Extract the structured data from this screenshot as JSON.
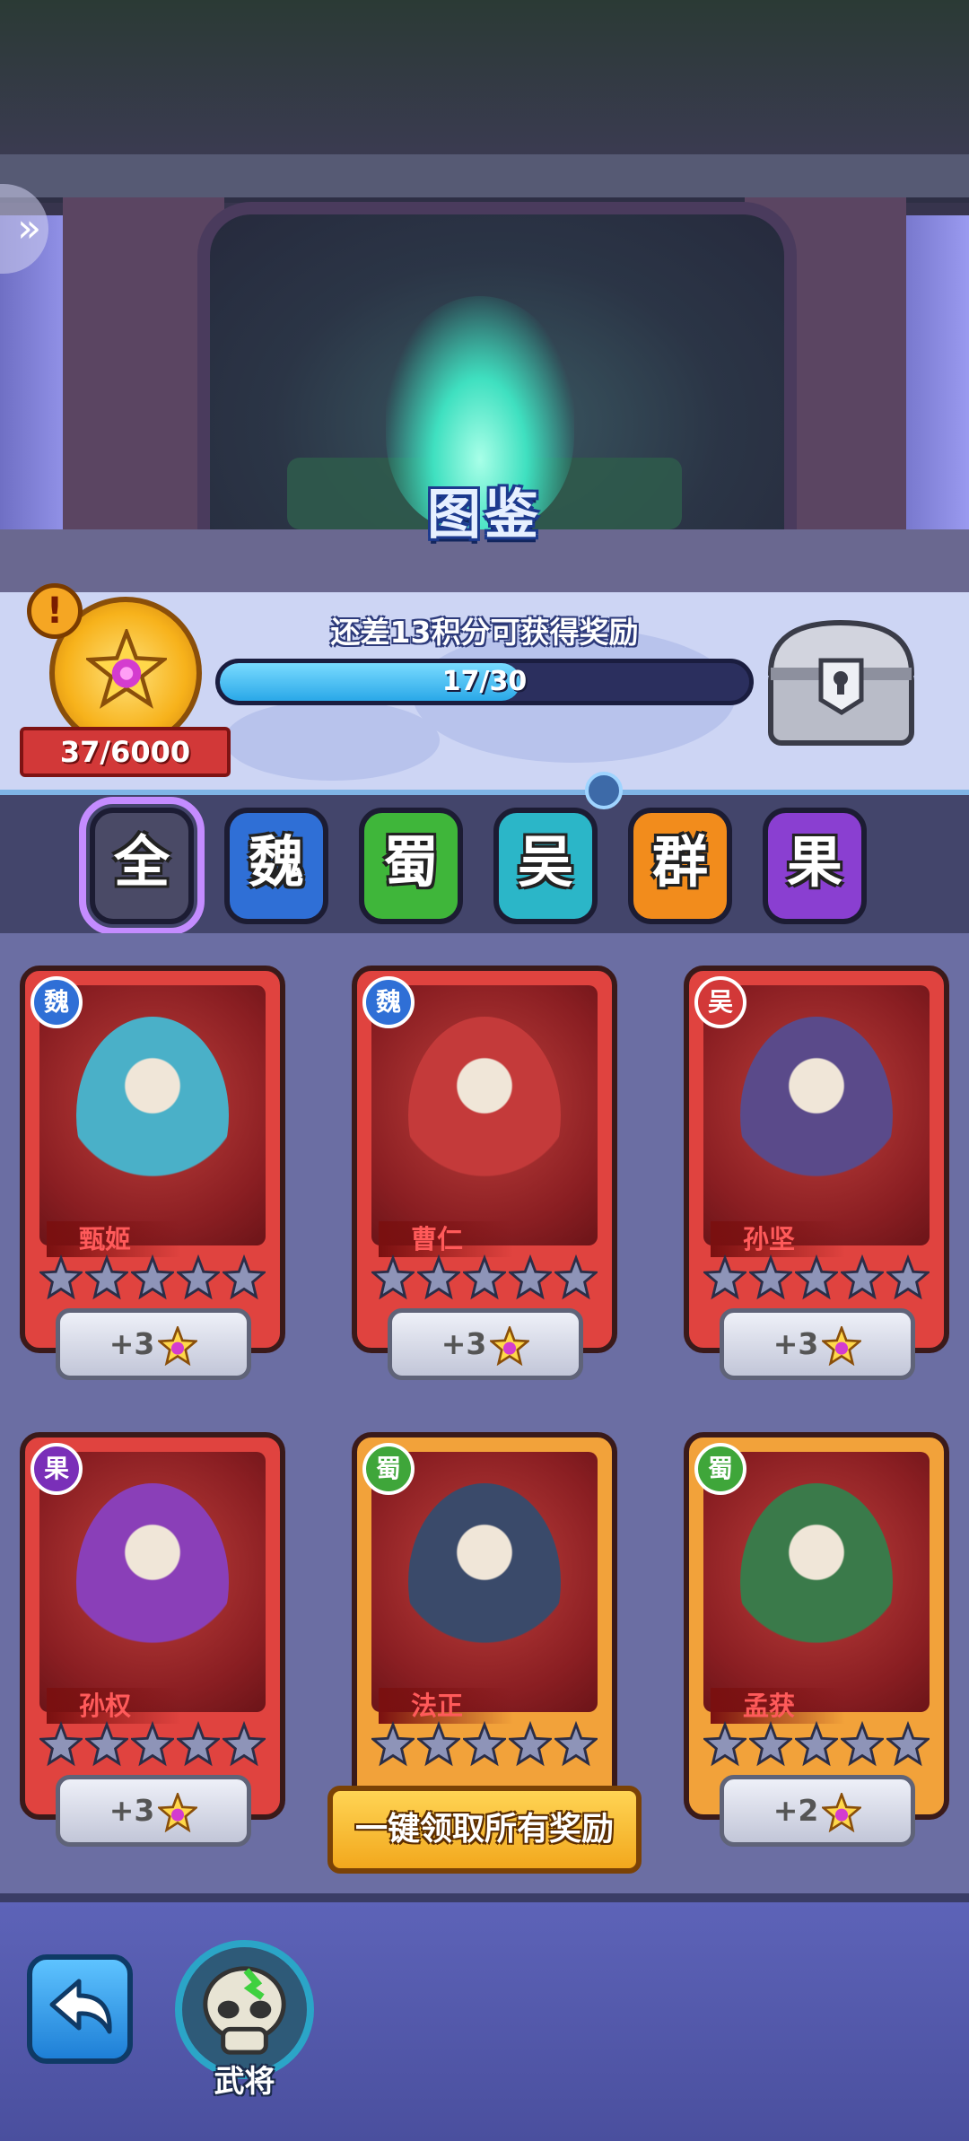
{
  "header": {
    "title": "图鉴",
    "side_tab_icon": "double-chevron-icon"
  },
  "progress": {
    "points_label": "37/6000",
    "reward_hint": "还差13积分可获得奖励",
    "bar_label": "17/30",
    "bar_progress": 0.567,
    "medal_alert": "!"
  },
  "factions": [
    {
      "label": "全",
      "color": "#4a4a66",
      "selected": true
    },
    {
      "label": "魏",
      "color": "#2f6fd6"
    },
    {
      "label": "蜀",
      "color": "#3fb63a"
    },
    {
      "label": "吴",
      "color": "#2bb6c8"
    },
    {
      "label": "群",
      "color": "#f28c1c"
    },
    {
      "label": "果",
      "color": "#8a3fd1"
    }
  ],
  "cards": [
    {
      "faction": "魏",
      "name": "甄姬",
      "bonus": "+3",
      "frame_color": "#e0433f",
      "badge_color": "#2f6fd6"
    },
    {
      "faction": "魏",
      "name": "曹仁",
      "bonus": "+3",
      "frame_color": "#e0433f",
      "badge_color": "#2f6fd6"
    },
    {
      "faction": "吴",
      "name": "孙坚",
      "bonus": "+3",
      "frame_color": "#e0433f",
      "badge_color": "#d23838"
    },
    {
      "faction": "果",
      "name": "孙权",
      "bonus": "+3",
      "frame_color": "#e0433f",
      "badge_color": "#7a2fb8"
    },
    {
      "faction": "蜀",
      "name": "法正",
      "bonus": "",
      "frame_color": "#f2a23a",
      "badge_color": "#3fa63a"
    },
    {
      "faction": "蜀",
      "name": "孟获",
      "bonus": "+2",
      "frame_color": "#f2a23a",
      "badge_color": "#3fa63a"
    }
  ],
  "stars_per_card": 5,
  "claim_all_label": "一键领取所有奖励",
  "bottom_nav": {
    "hero_label": "武将"
  }
}
